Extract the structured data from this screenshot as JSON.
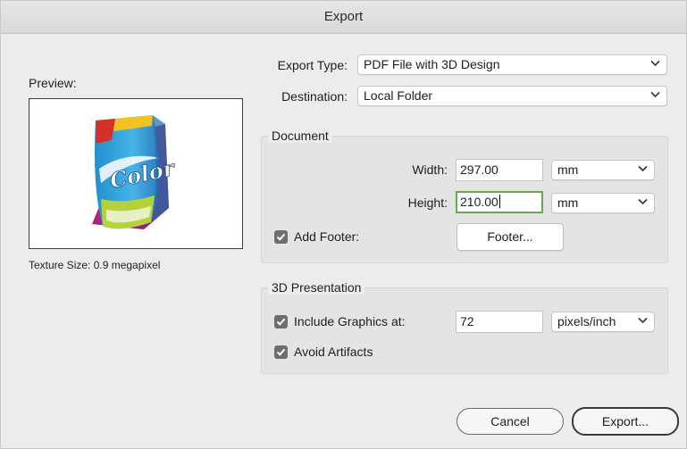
{
  "window": {
    "title": "Export"
  },
  "preview": {
    "label": "Preview:",
    "texture_size": "Texture Size: 0.9 megapixel",
    "product_label": "Color"
  },
  "export_type": {
    "label": "Export Type:",
    "value": "PDF File with 3D Design"
  },
  "destination": {
    "label": "Destination:",
    "value": "Local Folder"
  },
  "document": {
    "title": "Document",
    "width_label": "Width:",
    "width_value": "297.00",
    "width_unit": "mm",
    "height_label": "Height:",
    "height_value": "210.00",
    "height_unit": "mm",
    "add_footer_label": "Add Footer:",
    "add_footer_checked": true,
    "footer_button": "Footer..."
  },
  "presentation": {
    "title": "3D Presentation",
    "include_graphics_label": "Include Graphics at:",
    "include_graphics_checked": true,
    "resolution_value": "72",
    "resolution_unit": "pixels/inch",
    "avoid_artifacts_label": "Avoid Artifacts",
    "avoid_artifacts_checked": true
  },
  "buttons": {
    "cancel": "Cancel",
    "export": "Export..."
  },
  "colors": {
    "focus_ring": "#6aa84f",
    "checkbox": "#6e6e6e"
  },
  "icons": {
    "chevron": "chevron-down-icon",
    "check": "checkmark-icon"
  }
}
